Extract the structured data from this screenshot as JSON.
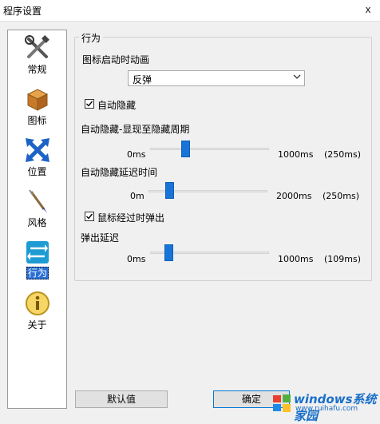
{
  "window": {
    "title": "程序设置",
    "close_label": "x"
  },
  "sidebar": {
    "items": [
      {
        "label": "常规",
        "icon": "tools-icon"
      },
      {
        "label": "图标",
        "icon": "box-icon"
      },
      {
        "label": "位置",
        "icon": "position-arrows-icon"
      },
      {
        "label": "风格",
        "icon": "brush-icon"
      },
      {
        "label": "行为",
        "icon": "behavior-arrows-icon",
        "active": true
      },
      {
        "label": "关于",
        "icon": "info-icon"
      }
    ]
  },
  "group": {
    "title": "行为",
    "animation_label": "图标启动时动画",
    "animation_value": "反弹",
    "autohide_label": "自动隐藏",
    "autohide_checked": true,
    "hide_cycle": {
      "label": "自动隐藏-显现至隐藏周期",
      "min": "0ms",
      "max": "1000ms",
      "value_text": "(250ms)",
      "value": 250,
      "range": [
        0,
        1000
      ]
    },
    "hide_delay": {
      "label": "自动隐藏延迟时间",
      "min": "0m",
      "max": "2000ms",
      "value_text": "(250ms)",
      "value": 250,
      "range": [
        0,
        2000
      ]
    },
    "hover_popup_label": "鼠标经过时弹出",
    "hover_popup_checked": true,
    "popup_delay": {
      "label": "弹出延迟",
      "min": "0ms",
      "max": "1000ms",
      "value_text": "(109ms)",
      "value": 109,
      "range": [
        0,
        1000
      ]
    }
  },
  "buttons": {
    "default_label": "默认值",
    "ok_label": "确定"
  },
  "watermark": {
    "line1": "windows系统家园",
    "line2": "www.ruihafu.com"
  },
  "colors": {
    "accent": "#1874d6",
    "active_nav": "#2a6fd5"
  }
}
